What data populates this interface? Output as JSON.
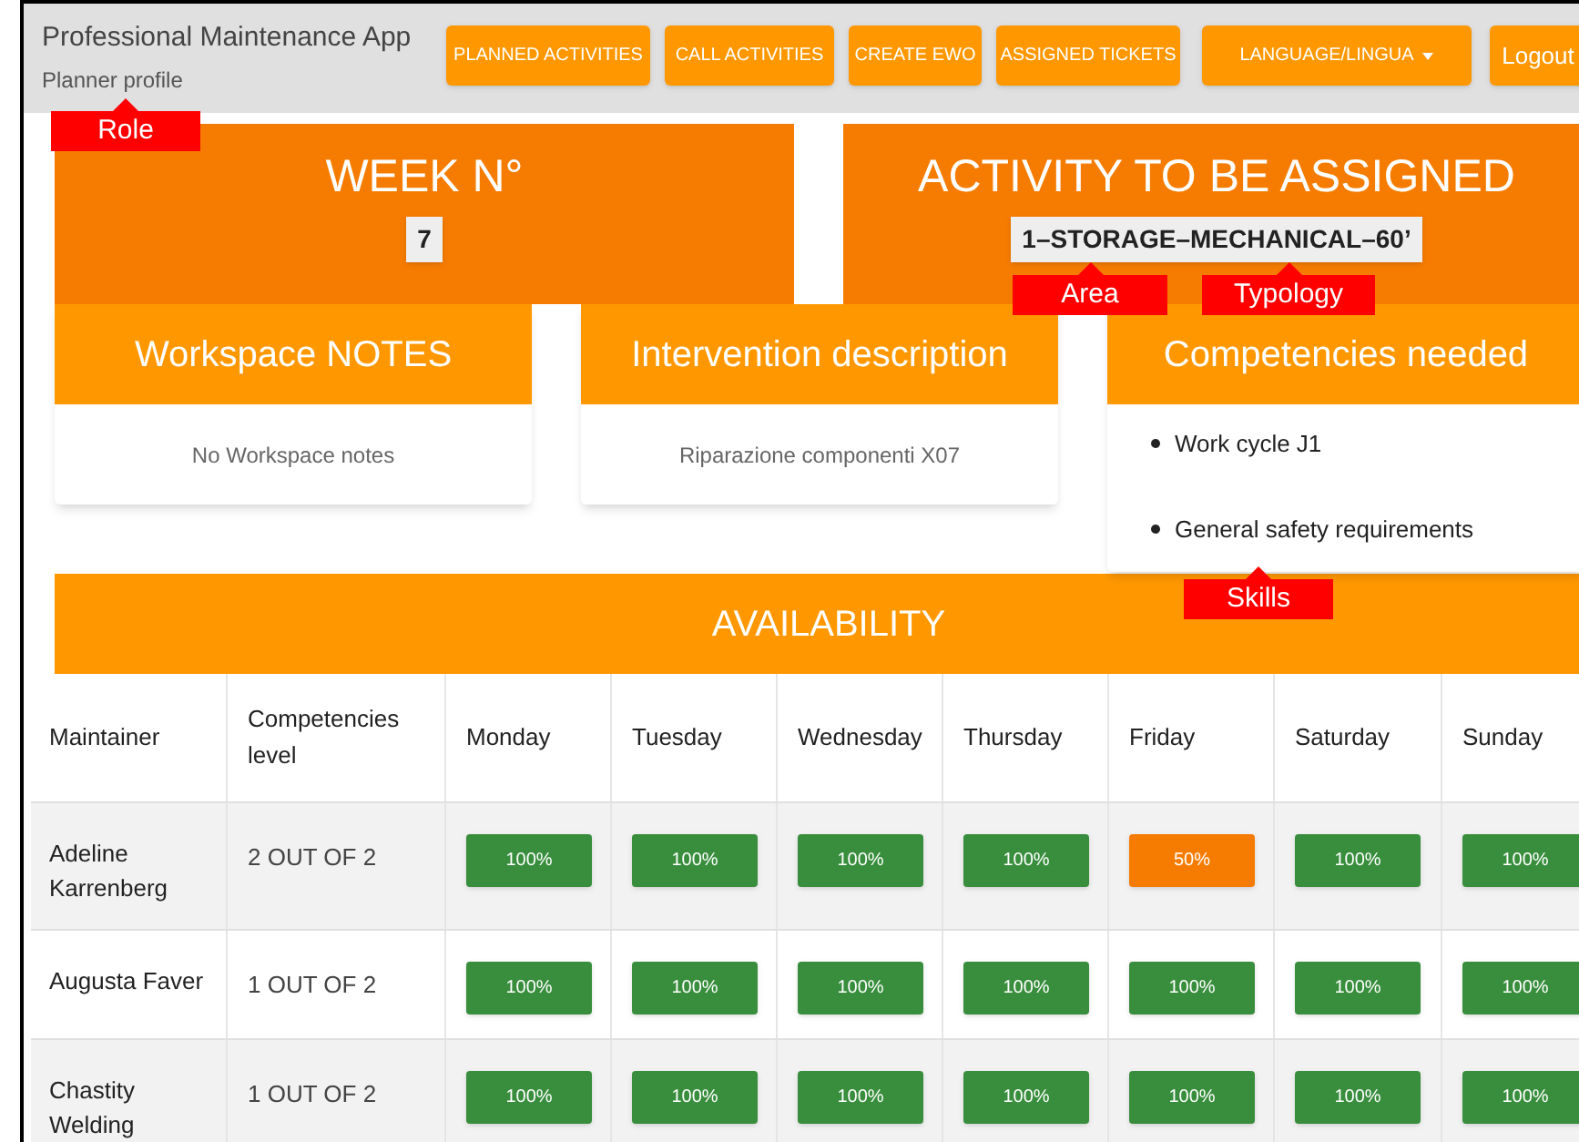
{
  "header": {
    "title": "Professional Maintenance App",
    "subtitle": "Planner profile",
    "nav": [
      {
        "label": "PLANNED ACTIVITIES",
        "kind": "button"
      },
      {
        "label": "CALL ACTIVITIES",
        "kind": "button"
      },
      {
        "label": "CREATE EWO",
        "kind": "button"
      },
      {
        "label": "ASSIGNED TICKETS",
        "kind": "button"
      },
      {
        "label": "LANGUAGE/LINGUA",
        "kind": "dropdown"
      },
      {
        "label": "Logout",
        "kind": "button"
      }
    ]
  },
  "week": {
    "title": "WEEK N°",
    "value": "7"
  },
  "activity": {
    "title": "ACTIVITY TO BE ASSIGNED",
    "value": "1–STORAGE–MECHANICAL–60’"
  },
  "cards": [
    {
      "title": "Workspace NOTES",
      "kind": "text",
      "text": "No Workspace notes"
    },
    {
      "title": "Intervention description",
      "kind": "text",
      "text": "Riparazione componenti X07"
    },
    {
      "title": "Competencies needed",
      "kind": "list",
      "items": [
        "Work cycle J1",
        "General safety requirements"
      ]
    }
  ],
  "availability": {
    "title": "AVAILABILITY",
    "columns": [
      "Maintainer",
      "Competencies level",
      "Monday",
      "Tuesday",
      "Wednesday",
      "Thursday",
      "Friday",
      "Saturday",
      "Sunday"
    ],
    "rows": [
      {
        "maintainer": "Adeline Karrenberg",
        "competencies": "2 OUT OF 2",
        "days": [
          {
            "value": "100%",
            "color": "#388e3c"
          },
          {
            "value": "100%",
            "color": "#388e3c"
          },
          {
            "value": "100%",
            "color": "#388e3c"
          },
          {
            "value": "100%",
            "color": "#388e3c"
          },
          {
            "value": "50%",
            "color": "#f57c00"
          },
          {
            "value": "100%",
            "color": "#388e3c"
          },
          {
            "value": "100%",
            "color": "#388e3c"
          }
        ]
      },
      {
        "maintainer": "Augusta Faver",
        "competencies": "1 OUT OF 2",
        "days": [
          {
            "value": "100%",
            "color": "#388e3c"
          },
          {
            "value": "100%",
            "color": "#388e3c"
          },
          {
            "value": "100%",
            "color": "#388e3c"
          },
          {
            "value": "100%",
            "color": "#388e3c"
          },
          {
            "value": "100%",
            "color": "#388e3c"
          },
          {
            "value": "100%",
            "color": "#388e3c"
          },
          {
            "value": "100%",
            "color": "#388e3c"
          }
        ]
      },
      {
        "maintainer": "Chastity Welding",
        "competencies": "1 OUT OF 2",
        "days": [
          {
            "value": "100%",
            "color": "#388e3c"
          },
          {
            "value": "100%",
            "color": "#388e3c"
          },
          {
            "value": "100%",
            "color": "#388e3c"
          },
          {
            "value": "100%",
            "color": "#388e3c"
          },
          {
            "value": "100%",
            "color": "#388e3c"
          },
          {
            "value": "100%",
            "color": "#388e3c"
          },
          {
            "value": "100%",
            "color": "#388e3c"
          }
        ]
      }
    ]
  },
  "annotations": [
    {
      "label": "Role"
    },
    {
      "label": "Area"
    },
    {
      "label": "Typology"
    },
    {
      "label": "Skills"
    }
  ]
}
